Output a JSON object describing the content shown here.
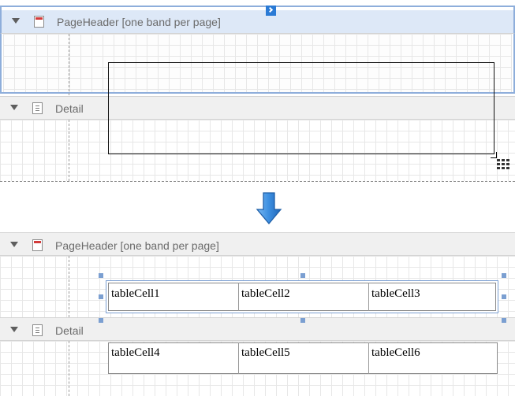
{
  "top": {
    "bands": {
      "page_header": "PageHeader [one band per page]",
      "detail": "Detail"
    },
    "smart_tag_icon": "chevron-right-icon",
    "table_drop_icon": "table-grid-icon"
  },
  "separator": {
    "arrow_icon": "down-arrow-icon"
  },
  "bottom": {
    "bands": {
      "page_header": "PageHeader [one band per page]",
      "detail": "Detail"
    },
    "header_cells": [
      "tableCell1",
      "tableCell2",
      "tableCell3"
    ],
    "detail_cells": [
      "tableCell4",
      "tableCell5",
      "tableCell6"
    ]
  },
  "colors": {
    "selection_blue": "#7b9fd1",
    "arrow_blue": "#3c8ee0",
    "pageheader_icon_red": "#d23b3b"
  }
}
